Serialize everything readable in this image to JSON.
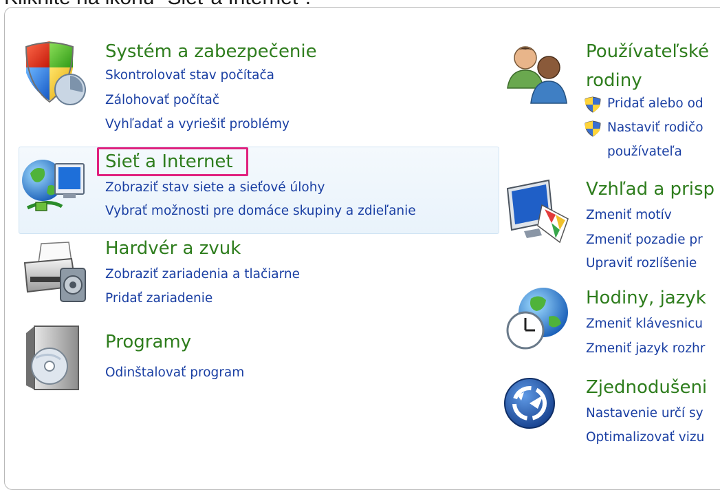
{
  "caption": "Kliknite na ikonu \"Sieť a Internet\".",
  "left_column": [
    {
      "name": "system",
      "title": "Systém a zabezpečenie",
      "icon": "shield-icon",
      "links": [
        "Skontrolovať stav počítača",
        "Zálohovať počítač",
        "Vyhľadať a vyriešiť problémy"
      ]
    },
    {
      "name": "network",
      "title": "Sieť a Internet",
      "icon": "globe-network-icon",
      "links": [
        "Zobraziť stav siete a sieťové úlohy",
        "Vybrať možnosti pre domáce skupiny a zdieľanie"
      ]
    },
    {
      "name": "hardware",
      "title": "Hardvér a zvuk",
      "icon": "printer-icon",
      "links": [
        "Zobraziť zariadenia a tlačiarne",
        "Pridať zariadenie"
      ]
    },
    {
      "name": "programs",
      "title": "Programy",
      "icon": "programs-icon",
      "links": [
        "Odinštalovať program"
      ]
    }
  ],
  "right_column": [
    {
      "name": "users",
      "title": "Používateľské",
      "title_line2": "rodiny",
      "icon": "users-icon",
      "links": [
        "Pridať alebo od",
        "Nastaviť rodičo",
        "používateľa"
      ]
    },
    {
      "name": "appearance",
      "title": "Vzhľad a prisp",
      "icon": "monitor-palette-icon",
      "links": [
        "Zmeniť motív",
        "Zmeniť pozadie pr",
        "Upraviť rozlíšenie"
      ]
    },
    {
      "name": "clock",
      "title": "Hodiny, jazyk",
      "icon": "clock-globe-icon",
      "links": [
        "Zmeniť klávesnicu",
        "Zmeniť jazyk rozhr"
      ]
    },
    {
      "name": "ease",
      "title": "Zjednodušeni",
      "icon": "ease-of-access-icon",
      "links": [
        "Nastavenie určí sy",
        "Optimalizovať vizu"
      ]
    }
  ],
  "colors": {
    "title_green": "#2e7d1d",
    "link_blue": "#1a3fa3",
    "highlight_pink": "#e0217e",
    "hover_bg": "#eaf4fc"
  }
}
